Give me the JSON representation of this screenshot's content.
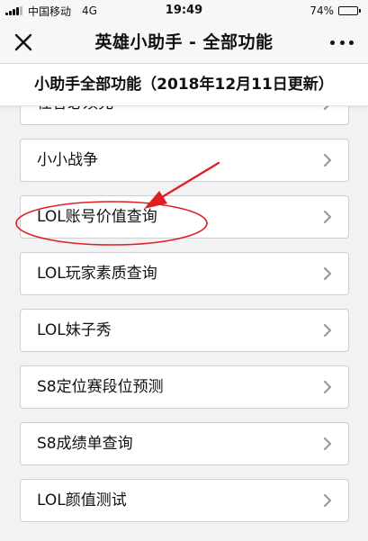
{
  "status_bar": {
    "carrier": "中国移动",
    "network": "4G",
    "time": "19:49",
    "battery": "74%",
    "battery_level": 0.74
  },
  "nav": {
    "title": "英雄小助手 - 全部功能",
    "close_icon": "close-icon",
    "more_icon": "more-dots-icon"
  },
  "page": {
    "header": "小助手全部功能（2018年12月11日更新）"
  },
  "list": {
    "items": [
      {
        "label": "任答必须充"
      },
      {
        "label": "小小战争"
      },
      {
        "label": "LOL账号价值查询"
      },
      {
        "label": "LOL玩家素质查询"
      },
      {
        "label": "LOL妹子秀"
      },
      {
        "label": "S8定位赛段位预测"
      },
      {
        "label": "S8成绩单查询"
      },
      {
        "label": "LOL颜值测试"
      }
    ],
    "chevron_icon": "chevron-right-icon"
  },
  "annotation": {
    "highlighted_item": "LOL账号价值查询",
    "color": "#e02020"
  }
}
